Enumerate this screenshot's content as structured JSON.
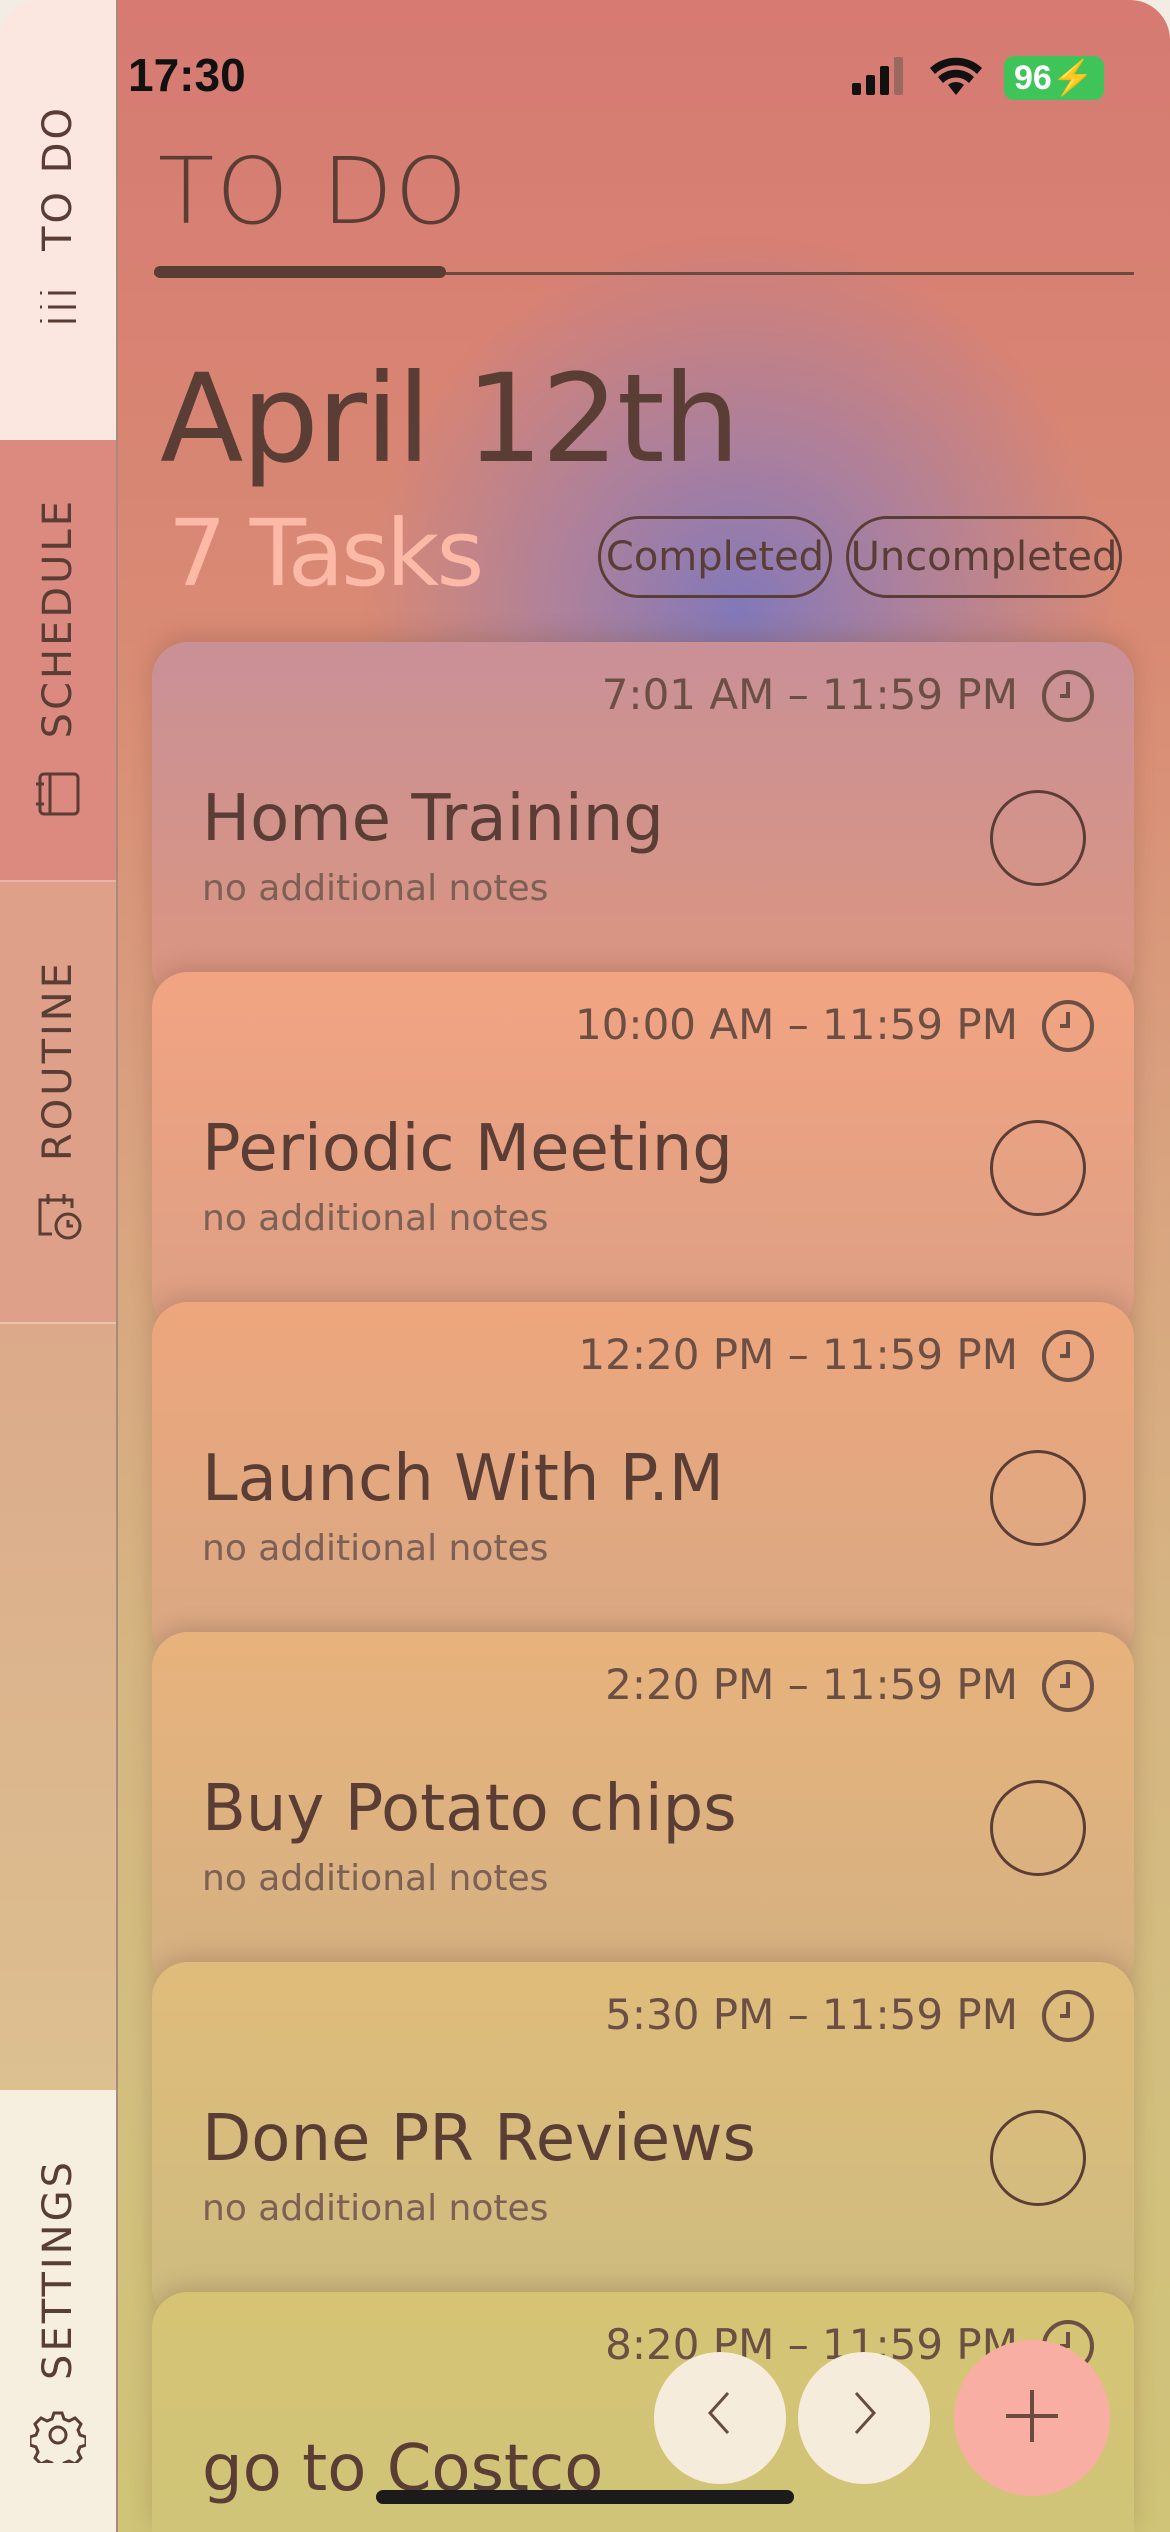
{
  "status_bar": {
    "time": "17:30",
    "battery": "96"
  },
  "sidebar": {
    "tabs": [
      {
        "label": "TO DO"
      },
      {
        "label": "SCHEDULE"
      },
      {
        "label": "ROUTINE"
      },
      {
        "label": "SETTINGS"
      }
    ]
  },
  "header": {
    "title": "TO DO"
  },
  "date": "April 12th",
  "task_count": "7 Tasks",
  "filters": {
    "completed": "Completed",
    "uncompleted": "Uncompleted"
  },
  "tasks": [
    {
      "time": "7:01 AM – 11:59 PM",
      "name": "Home Training",
      "notes": "no additional notes"
    },
    {
      "time": "10:00 AM – 11:59 PM",
      "name": " Periodic Meeting",
      "notes": "no additional notes"
    },
    {
      "time": "12:20 PM – 11:59 PM",
      "name": "Launch With P.M",
      "notes": "no additional notes"
    },
    {
      "time": "2:20 PM – 11:59 PM",
      "name": "Buy Potato chips",
      "notes": "no additional notes"
    },
    {
      "time": "5:30 PM – 11:59 PM",
      "name": "Done PR Reviews",
      "notes": "no additional notes"
    },
    {
      "time": "8:20 PM – 11:59 PM",
      "name": "go to Costco",
      "notes": ""
    }
  ],
  "colors": {
    "accent": "#5a3e35",
    "count": "#fbb9a6",
    "add_button": "#f8aea2"
  }
}
